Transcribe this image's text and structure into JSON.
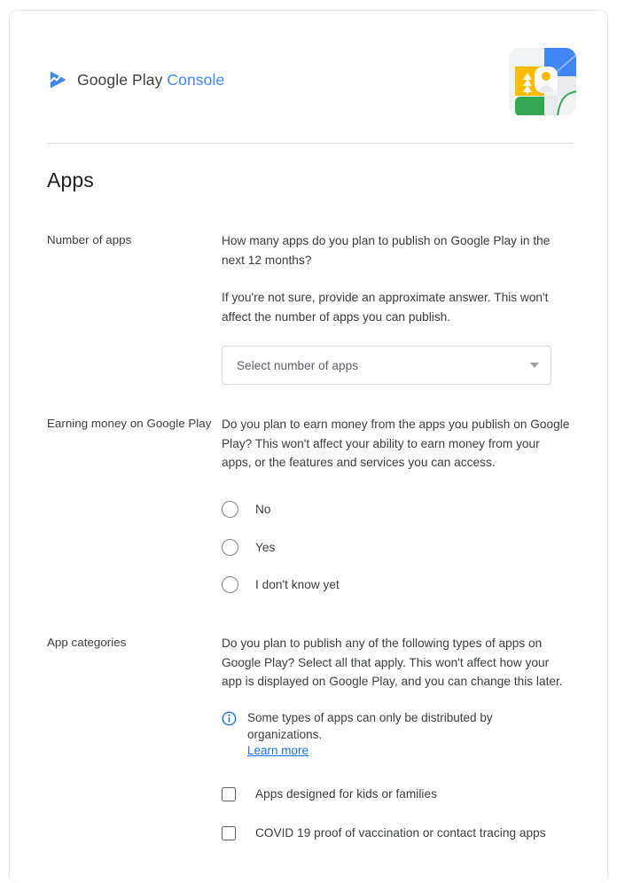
{
  "brand": {
    "logo_icon": "play-console-logo-icon",
    "name_primary": "Google Play",
    "name_secondary": "Console",
    "illustration_icon": "developer-profile-map-illustration"
  },
  "page": {
    "title": "Apps"
  },
  "sections": {
    "number_of_apps": {
      "label": "Number of apps",
      "question": "How many apps do you plan to publish on Google Play in the next 12 months?",
      "note": "If you're not sure, provide an approximate answer. This won't affect the number of apps you can publish.",
      "select": {
        "value": "Select number of apps",
        "arrow_icon": "chevron-down-icon"
      }
    },
    "earning_money": {
      "label": "Earning money on Google Play",
      "question": "Do you plan to earn money from the apps you publish on Google Play? This won't affect your ability to earn money from your apps, or the features and services you can access.",
      "options": [
        {
          "label": "No",
          "selected": false
        },
        {
          "label": "Yes",
          "selected": false
        },
        {
          "label": "I don't know yet",
          "selected": false
        }
      ]
    },
    "app_categories": {
      "label": "App categories",
      "question": "Do you plan to publish any of the following types of apps on Google Play? Select all that apply. This won't affect how your app is displayed on Google Play, and you can change this later.",
      "info": {
        "icon": "info-icon",
        "text": "Some types of apps can only be distributed by organizations.",
        "link_label": "Learn more"
      },
      "checkboxes": [
        {
          "label": "Apps designed for kids or families",
          "checked": false
        },
        {
          "label": "COVID 19 proof of vaccination or contact tracing apps",
          "checked": false
        }
      ]
    }
  },
  "colors": {
    "brand_blue": "#4285f4",
    "link_blue": "#1a73e8",
    "text_primary": "#202124",
    "text_secondary": "#3c4043",
    "border": "#dadce0"
  }
}
